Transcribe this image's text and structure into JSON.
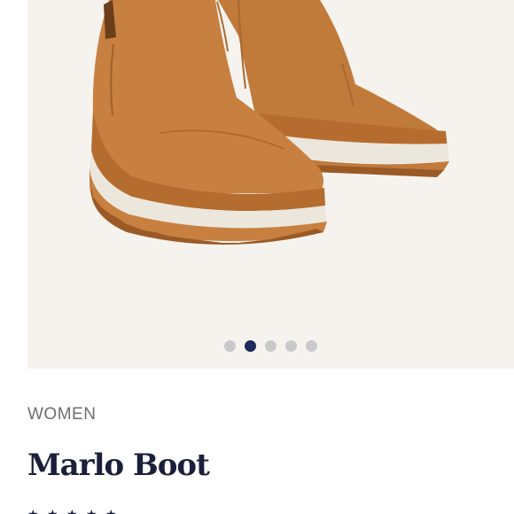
{
  "product": {
    "category": "WOMEN",
    "name": "Marlo Boot",
    "image_icon": "boot-product-photo"
  },
  "carousel": {
    "slide_count": 5,
    "active_index": 1,
    "colors": {
      "active": "#1d2a5a",
      "inactive": "#c9c9c9"
    }
  },
  "rating": {
    "stars": [
      "★",
      "★",
      "★",
      "★",
      "★"
    ]
  },
  "colors": {
    "gallery_bg": "#f6f3ee",
    "title": "#1b1f3b",
    "category": "#6e6e6e"
  }
}
